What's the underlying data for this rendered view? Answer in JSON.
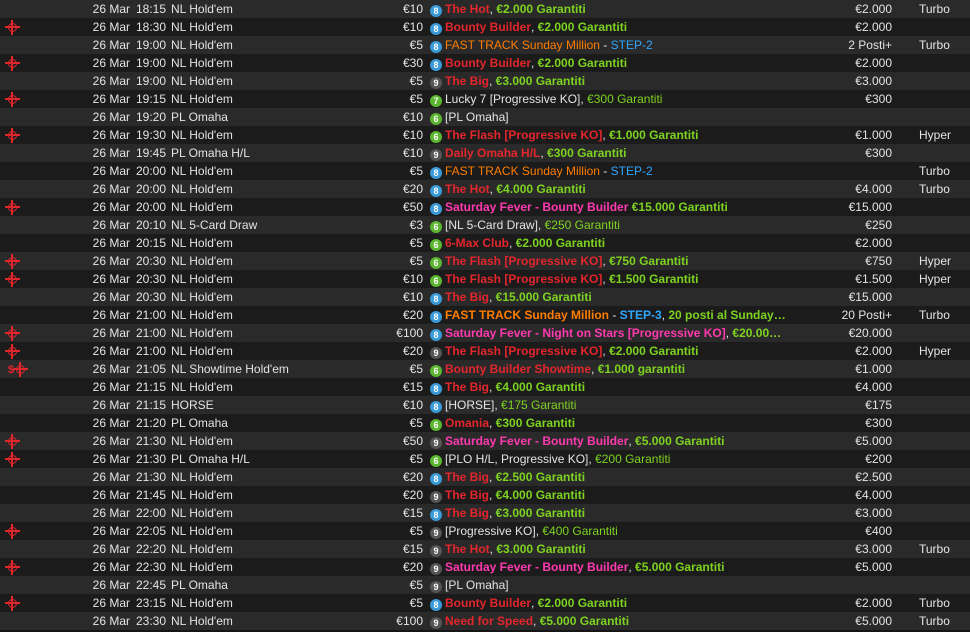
{
  "colors": {
    "red": "#e3262c",
    "green": "#7ed321",
    "pink": "#ff3ab0",
    "orange": "#ff7d00",
    "blue": "#2fa7ff",
    "white": "#e4e4e4",
    "badge_blue": "#3a9ad9",
    "badge_green": "#5cb531",
    "badge_gray": "#555555"
  },
  "icons": {
    "target": "crosshair-target-icon",
    "dollar": "dollar-icon"
  },
  "rows": [
    {
      "icons": [],
      "date": "26 Mar",
      "time": "18:15",
      "game": "NL Hold'em",
      "buyin": "€10",
      "badge": "8",
      "badge_color": "badge_blue",
      "name": [
        {
          "t": "The Hot",
          "c": "red",
          "b": true
        },
        {
          "t": ", ",
          "c": "white"
        },
        {
          "t": "€2.000 Garantiti",
          "c": "green",
          "b": true
        }
      ],
      "prize": "€2.000",
      "speed": "Turbo"
    },
    {
      "icons": [
        "target"
      ],
      "date": "26 Mar",
      "time": "18:30",
      "game": "NL Hold'em",
      "buyin": "€10",
      "badge": "8",
      "badge_color": "badge_blue",
      "name": [
        {
          "t": "Bounty Builder",
          "c": "red",
          "b": true
        },
        {
          "t": ", ",
          "c": "white"
        },
        {
          "t": "€2.000 Garantiti",
          "c": "green",
          "b": true
        }
      ],
      "prize": "€2.000",
      "speed": ""
    },
    {
      "icons": [],
      "date": "26 Mar",
      "time": "19:00",
      "game": "NL Hold'em",
      "buyin": "€5",
      "badge": "8",
      "badge_color": "badge_blue",
      "name": [
        {
          "t": "FAST TRACK Sunday Million",
          "c": "orange"
        },
        {
          "t": " - ",
          "c": "white"
        },
        {
          "t": "STEP-2",
          "c": "blue"
        }
      ],
      "prize": "2 Posti+",
      "speed": "Turbo"
    },
    {
      "icons": [
        "target"
      ],
      "date": "26 Mar",
      "time": "19:00",
      "game": "NL Hold'em",
      "buyin": "€30",
      "badge": "8",
      "badge_color": "badge_blue",
      "name": [
        {
          "t": "Bounty Builder",
          "c": "red",
          "b": true
        },
        {
          "t": ", ",
          "c": "white"
        },
        {
          "t": "€2.000 Garantiti",
          "c": "green",
          "b": true
        }
      ],
      "prize": "€2.000",
      "speed": ""
    },
    {
      "icons": [],
      "date": "26 Mar",
      "time": "19:00",
      "game": "NL Hold'em",
      "buyin": "€5",
      "badge": "9",
      "badge_color": "badge_gray",
      "name": [
        {
          "t": "The Big",
          "c": "red",
          "b": true
        },
        {
          "t": ", ",
          "c": "white"
        },
        {
          "t": "€3.000 Garantiti",
          "c": "green",
          "b": true
        }
      ],
      "prize": "€3.000",
      "speed": ""
    },
    {
      "icons": [
        "target"
      ],
      "date": "26 Mar",
      "time": "19:15",
      "game": "NL Hold'em",
      "buyin": "€5",
      "badge": "7",
      "badge_color": "badge_green",
      "name": [
        {
          "t": "Lucky 7 [Progressive KO], ",
          "c": "white"
        },
        {
          "t": "€300 Garantiti",
          "c": "green"
        }
      ],
      "prize": "€300",
      "speed": ""
    },
    {
      "icons": [],
      "date": "26 Mar",
      "time": "19:20",
      "game": "PL Omaha",
      "buyin": "€10",
      "badge": "6",
      "badge_color": "badge_green",
      "name": [
        {
          "t": "[PL Omaha]",
          "c": "white"
        }
      ],
      "prize": "",
      "speed": ""
    },
    {
      "icons": [
        "target"
      ],
      "date": "26 Mar",
      "time": "19:30",
      "game": "NL Hold'em",
      "buyin": "€10",
      "badge": "6",
      "badge_color": "badge_green",
      "name": [
        {
          "t": "The Flash [Progressive KO]",
          "c": "red",
          "b": true
        },
        {
          "t": ", ",
          "c": "white"
        },
        {
          "t": "€1.000 Garantiti",
          "c": "green",
          "b": true
        }
      ],
      "prize": "€1.000",
      "speed": "Hyper"
    },
    {
      "icons": [],
      "date": "26 Mar",
      "time": "19:45",
      "game": "PL Omaha H/L",
      "buyin": "€10",
      "badge": "9",
      "badge_color": "badge_gray",
      "name": [
        {
          "t": "Daily Omaha H/L",
          "c": "red",
          "b": true
        },
        {
          "t": ", ",
          "c": "white"
        },
        {
          "t": "€300 Garantiti",
          "c": "green",
          "b": true
        }
      ],
      "prize": "€300",
      "speed": ""
    },
    {
      "icons": [],
      "date": "26 Mar",
      "time": "20:00",
      "game": "NL Hold'em",
      "buyin": "€5",
      "badge": "8",
      "badge_color": "badge_blue",
      "name": [
        {
          "t": "FAST TRACK Sunday Million",
          "c": "orange"
        },
        {
          "t": " - ",
          "c": "white"
        },
        {
          "t": "STEP-2",
          "c": "blue"
        }
      ],
      "prize": "",
      "speed": "Turbo"
    },
    {
      "icons": [],
      "date": "26 Mar",
      "time": "20:00",
      "game": "NL Hold'em",
      "buyin": "€20",
      "badge": "8",
      "badge_color": "badge_blue",
      "name": [
        {
          "t": "The Hot",
          "c": "red",
          "b": true
        },
        {
          "t": ", ",
          "c": "white"
        },
        {
          "t": "€4.000 Garantiti",
          "c": "green",
          "b": true
        }
      ],
      "prize": "€4.000",
      "speed": "Turbo"
    },
    {
      "icons": [
        "target"
      ],
      "date": "26 Mar",
      "time": "20:00",
      "game": "NL Hold'em",
      "buyin": "€50",
      "badge": "8",
      "badge_color": "badge_blue",
      "name": [
        {
          "t": "Saturday Fever - Bounty Builder",
          "c": "pink",
          "b": true
        },
        {
          "t": " ",
          "c": "white"
        },
        {
          "t": "€15.000 Garantiti",
          "c": "green",
          "b": true
        }
      ],
      "prize": "€15.000",
      "speed": ""
    },
    {
      "icons": [],
      "date": "26 Mar",
      "time": "20:10",
      "game": "NL 5-Card Draw",
      "buyin": "€3",
      "badge": "6",
      "badge_color": "badge_green",
      "name": [
        {
          "t": "[NL 5-Card Draw], ",
          "c": "white"
        },
        {
          "t": "€250 Garantiti",
          "c": "green"
        }
      ],
      "prize": "€250",
      "speed": ""
    },
    {
      "icons": [],
      "date": "26 Mar",
      "time": "20:15",
      "game": "NL Hold'em",
      "buyin": "€5",
      "badge": "6",
      "badge_color": "badge_green",
      "name": [
        {
          "t": "6-Max Club",
          "c": "red",
          "b": true
        },
        {
          "t": ", ",
          "c": "white"
        },
        {
          "t": "€2.000 Garantiti",
          "c": "green",
          "b": true
        }
      ],
      "prize": "€2.000",
      "speed": ""
    },
    {
      "icons": [
        "target"
      ],
      "date": "26 Mar",
      "time": "20:30",
      "game": "NL Hold'em",
      "buyin": "€5",
      "badge": "6",
      "badge_color": "badge_green",
      "name": [
        {
          "t": "The Flash [Progressive KO]",
          "c": "red",
          "b": true
        },
        {
          "t": ", ",
          "c": "white"
        },
        {
          "t": "€750 Garantiti",
          "c": "green",
          "b": true
        }
      ],
      "prize": "€750",
      "speed": "Hyper"
    },
    {
      "icons": [
        "target"
      ],
      "date": "26 Mar",
      "time": "20:30",
      "game": "NL Hold'em",
      "buyin": "€10",
      "badge": "6",
      "badge_color": "badge_green",
      "name": [
        {
          "t": "The Flash [Progressive KO]",
          "c": "red",
          "b": true
        },
        {
          "t": ", ",
          "c": "white"
        },
        {
          "t": "€1.500 Garantiti",
          "c": "green",
          "b": true
        }
      ],
      "prize": "€1.500",
      "speed": "Hyper"
    },
    {
      "icons": [],
      "date": "26 Mar",
      "time": "20:30",
      "game": "NL Hold'em",
      "buyin": "€10",
      "badge": "8",
      "badge_color": "badge_blue",
      "name": [
        {
          "t": "The Big",
          "c": "red",
          "b": true
        },
        {
          "t": ", ",
          "c": "white"
        },
        {
          "t": "€15.000 Garantiti",
          "c": "green",
          "b": true
        }
      ],
      "prize": "€15.000",
      "speed": ""
    },
    {
      "icons": [],
      "date": "26 Mar",
      "time": "21:00",
      "game": "NL Hold'em",
      "buyin": "€20",
      "badge": "8",
      "badge_color": "badge_blue",
      "name": [
        {
          "t": "FAST TRACK Sunday Million",
          "c": "orange",
          "b": true
        },
        {
          "t": " - ",
          "c": "white"
        },
        {
          "t": "STEP-3",
          "c": "blue",
          "b": true
        },
        {
          "t": ", ",
          "c": "white"
        },
        {
          "t": "20 posti al Sunday…",
          "c": "green",
          "b": true
        }
      ],
      "prize": "20 Posti+",
      "speed": "Turbo"
    },
    {
      "icons": [
        "target"
      ],
      "date": "26 Mar",
      "time": "21:00",
      "game": "NL Hold'em",
      "buyin": "€100",
      "badge": "8",
      "badge_color": "badge_blue",
      "name": [
        {
          "t": "Saturday Fever - Night on Stars [Progressive KO]",
          "c": "pink",
          "b": true
        },
        {
          "t": ", ",
          "c": "white"
        },
        {
          "t": "€20.00…",
          "c": "green",
          "b": true
        }
      ],
      "prize": "€20.000",
      "speed": ""
    },
    {
      "icons": [
        "target"
      ],
      "date": "26 Mar",
      "time": "21:00",
      "game": "NL Hold'em",
      "buyin": "€20",
      "badge": "9",
      "badge_color": "badge_gray",
      "name": [
        {
          "t": "The Flash [Progressive KO]",
          "c": "red",
          "b": true
        },
        {
          "t": ", ",
          "c": "white"
        },
        {
          "t": "€2.000 Garantiti",
          "c": "green",
          "b": true
        }
      ],
      "prize": "€2.000",
      "speed": "Hyper"
    },
    {
      "icons": [
        "dollar",
        "target"
      ],
      "date": "26 Mar",
      "time": "21:05",
      "game": "NL Showtime Hold'em",
      "buyin": "€5",
      "badge": "6",
      "badge_color": "badge_green",
      "name": [
        {
          "t": "Bounty Builder Showtime",
          "c": "red",
          "b": true
        },
        {
          "t": ", ",
          "c": "white"
        },
        {
          "t": "€1.000 garantiti",
          "c": "green",
          "b": true
        }
      ],
      "prize": "€1.000",
      "speed": ""
    },
    {
      "icons": [],
      "date": "26 Mar",
      "time": "21:15",
      "game": "NL Hold'em",
      "buyin": "€15",
      "badge": "8",
      "badge_color": "badge_blue",
      "name": [
        {
          "t": "The Big",
          "c": "red",
          "b": true
        },
        {
          "t": ", ",
          "c": "white"
        },
        {
          "t": "€4.000 Garantiti",
          "c": "green",
          "b": true
        }
      ],
      "prize": "€4.000",
      "speed": ""
    },
    {
      "icons": [],
      "date": "26 Mar",
      "time": "21:15",
      "game": "HORSE",
      "buyin": "€10",
      "badge": "8",
      "badge_color": "badge_blue",
      "name": [
        {
          "t": "[HORSE], ",
          "c": "white"
        },
        {
          "t": "€175 Garantiti",
          "c": "green"
        }
      ],
      "prize": "€175",
      "speed": ""
    },
    {
      "icons": [],
      "date": "26 Mar",
      "time": "21:20",
      "game": "PL Omaha",
      "buyin": "€5",
      "badge": "6",
      "badge_color": "badge_green",
      "name": [
        {
          "t": "Omania",
          "c": "red",
          "b": true
        },
        {
          "t": ", ",
          "c": "white"
        },
        {
          "t": "€300 Garantiti",
          "c": "green",
          "b": true
        }
      ],
      "prize": "€300",
      "speed": ""
    },
    {
      "icons": [
        "target"
      ],
      "date": "26 Mar",
      "time": "21:30",
      "game": "NL Hold'em",
      "buyin": "€50",
      "badge": "9",
      "badge_color": "badge_gray",
      "name": [
        {
          "t": "Saturday Fever - Bounty Builder",
          "c": "pink",
          "b": true
        },
        {
          "t": ", ",
          "c": "white"
        },
        {
          "t": "€5.000 Garantiti",
          "c": "green",
          "b": true
        }
      ],
      "prize": "€5.000",
      "speed": ""
    },
    {
      "icons": [
        "target"
      ],
      "date": "26 Mar",
      "time": "21:30",
      "game": "PL Omaha H/L",
      "buyin": "€5",
      "badge": "6",
      "badge_color": "badge_green",
      "name": [
        {
          "t": "[PLO H/L, Progressive KO], ",
          "c": "white"
        },
        {
          "t": "€200 Garantiti",
          "c": "green"
        }
      ],
      "prize": "€200",
      "speed": ""
    },
    {
      "icons": [],
      "date": "26 Mar",
      "time": "21:30",
      "game": "NL Hold'em",
      "buyin": "€20",
      "badge": "8",
      "badge_color": "badge_blue",
      "name": [
        {
          "t": "The Big",
          "c": "red",
          "b": true
        },
        {
          "t": ", ",
          "c": "white"
        },
        {
          "t": "€2.500 Garantiti",
          "c": "green",
          "b": true
        }
      ],
      "prize": "€2.500",
      "speed": ""
    },
    {
      "icons": [],
      "date": "26 Mar",
      "time": "21:45",
      "game": "NL Hold'em",
      "buyin": "€20",
      "badge": "9",
      "badge_color": "badge_gray",
      "name": [
        {
          "t": "The Big",
          "c": "red",
          "b": true
        },
        {
          "t": ", ",
          "c": "white"
        },
        {
          "t": "€4.000 Garantiti",
          "c": "green",
          "b": true
        }
      ],
      "prize": "€4.000",
      "speed": ""
    },
    {
      "icons": [],
      "date": "26 Mar",
      "time": "22:00",
      "game": "NL Hold'em",
      "buyin": "€15",
      "badge": "8",
      "badge_color": "badge_blue",
      "name": [
        {
          "t": "The Big",
          "c": "red",
          "b": true
        },
        {
          "t": ", ",
          "c": "white"
        },
        {
          "t": "€3.000 Garantiti",
          "c": "green",
          "b": true
        }
      ],
      "prize": "€3.000",
      "speed": ""
    },
    {
      "icons": [
        "target"
      ],
      "date": "26 Mar",
      "time": "22:05",
      "game": "NL Hold'em",
      "buyin": "€5",
      "badge": "9",
      "badge_color": "badge_gray",
      "name": [
        {
          "t": "[Progressive KO], ",
          "c": "white"
        },
        {
          "t": "€400 Garantiti",
          "c": "green"
        }
      ],
      "prize": "€400",
      "speed": ""
    },
    {
      "icons": [],
      "date": "26 Mar",
      "time": "22:20",
      "game": "NL Hold'em",
      "buyin": "€15",
      "badge": "9",
      "badge_color": "badge_gray",
      "name": [
        {
          "t": "The Hot",
          "c": "red",
          "b": true
        },
        {
          "t": ", ",
          "c": "white"
        },
        {
          "t": "€3.000 Garantiti",
          "c": "green",
          "b": true
        }
      ],
      "prize": "€3.000",
      "speed": "Turbo"
    },
    {
      "icons": [
        "target"
      ],
      "date": "26 Mar",
      "time": "22:30",
      "game": "NL Hold'em",
      "buyin": "€20",
      "badge": "9",
      "badge_color": "badge_gray",
      "name": [
        {
          "t": "Saturday Fever - Bounty Builder",
          "c": "pink",
          "b": true
        },
        {
          "t": ", ",
          "c": "white"
        },
        {
          "t": "€5.000 Garantiti",
          "c": "green",
          "b": true
        }
      ],
      "prize": "€5.000",
      "speed": ""
    },
    {
      "icons": [],
      "date": "26 Mar",
      "time": "22:45",
      "game": "PL Omaha",
      "buyin": "€5",
      "badge": "9",
      "badge_color": "badge_gray",
      "name": [
        {
          "t": "[PL Omaha]",
          "c": "white"
        }
      ],
      "prize": "",
      "speed": ""
    },
    {
      "icons": [
        "target"
      ],
      "date": "26 Mar",
      "time": "23:15",
      "game": "NL Hold'em",
      "buyin": "€5",
      "badge": "8",
      "badge_color": "badge_blue",
      "name": [
        {
          "t": "Bounty Builder",
          "c": "red",
          "b": true
        },
        {
          "t": ", ",
          "c": "white"
        },
        {
          "t": "€2.000 Garantiti",
          "c": "green",
          "b": true
        }
      ],
      "prize": "€2.000",
      "speed": "Turbo"
    },
    {
      "icons": [],
      "date": "26 Mar",
      "time": "23:30",
      "game": "NL Hold'em",
      "buyin": "€100",
      "badge": "9",
      "badge_color": "badge_gray",
      "name": [
        {
          "t": "Need for Speed",
          "c": "red",
          "b": true
        },
        {
          "t": ", ",
          "c": "white"
        },
        {
          "t": "€5.000 Garantiti",
          "c": "green",
          "b": true
        }
      ],
      "prize": "€5.000",
      "speed": "Turbo"
    }
  ]
}
